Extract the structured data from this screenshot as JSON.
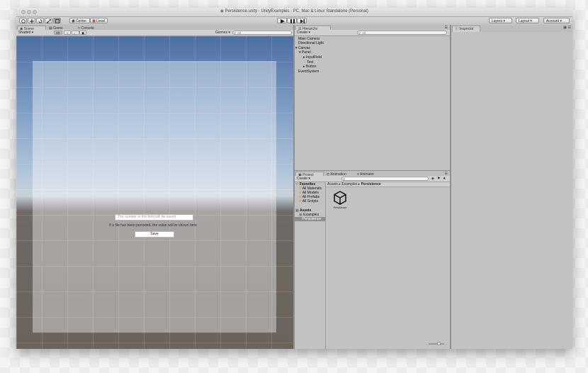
{
  "window": {
    "title": "Persistence.unity - UnityExamples - PC, Mac & Linux Standalone (Personal)"
  },
  "toolbar": {
    "pivot_label": "Center",
    "space_label": "Local",
    "layers_label": "Layers",
    "layout_label": "Layout",
    "account_label": "Account"
  },
  "scene_panel": {
    "tabs": [
      "Scene",
      "Game",
      "Console"
    ],
    "shading_mode": "Shaded",
    "mode_2d": "2D",
    "gizmos_label": "Gizmos",
    "search_placeholder": "All"
  },
  "game_ui": {
    "input_placeholder": "The number in this field will be saved",
    "status_text": "If a file has been persisted, the value will be shown here",
    "save_button": "Save"
  },
  "hierarchy": {
    "tab": "Hierarchy",
    "create_label": "Create",
    "search_placeholder": "All",
    "items": [
      "Main Camera",
      "Directional Light",
      "Canvas",
      "Panel",
      "InputField",
      "Text",
      "Button",
      "EventSystem"
    ]
  },
  "project": {
    "tabs": [
      "Project",
      "Animation",
      "Animator"
    ],
    "create_label": "Create",
    "favorites_label": "Favorites",
    "favorites": [
      "All Materials",
      "All Models",
      "All Prefabs",
      "All Scripts"
    ],
    "assets_label": "Assets",
    "examples_label": "Examples",
    "selected_folder": "Persistence",
    "breadcrumb": [
      "Assets",
      "Examples",
      "Persistence"
    ],
    "asset_name": "Persistence"
  },
  "inspector": {
    "tab": "Inspector"
  },
  "colors": {
    "scene_sky_top": "#4d6ea2",
    "scene_ground": "#6b635c",
    "panel_bg": "#c2c2c2",
    "selection": "#8e8e8e"
  }
}
